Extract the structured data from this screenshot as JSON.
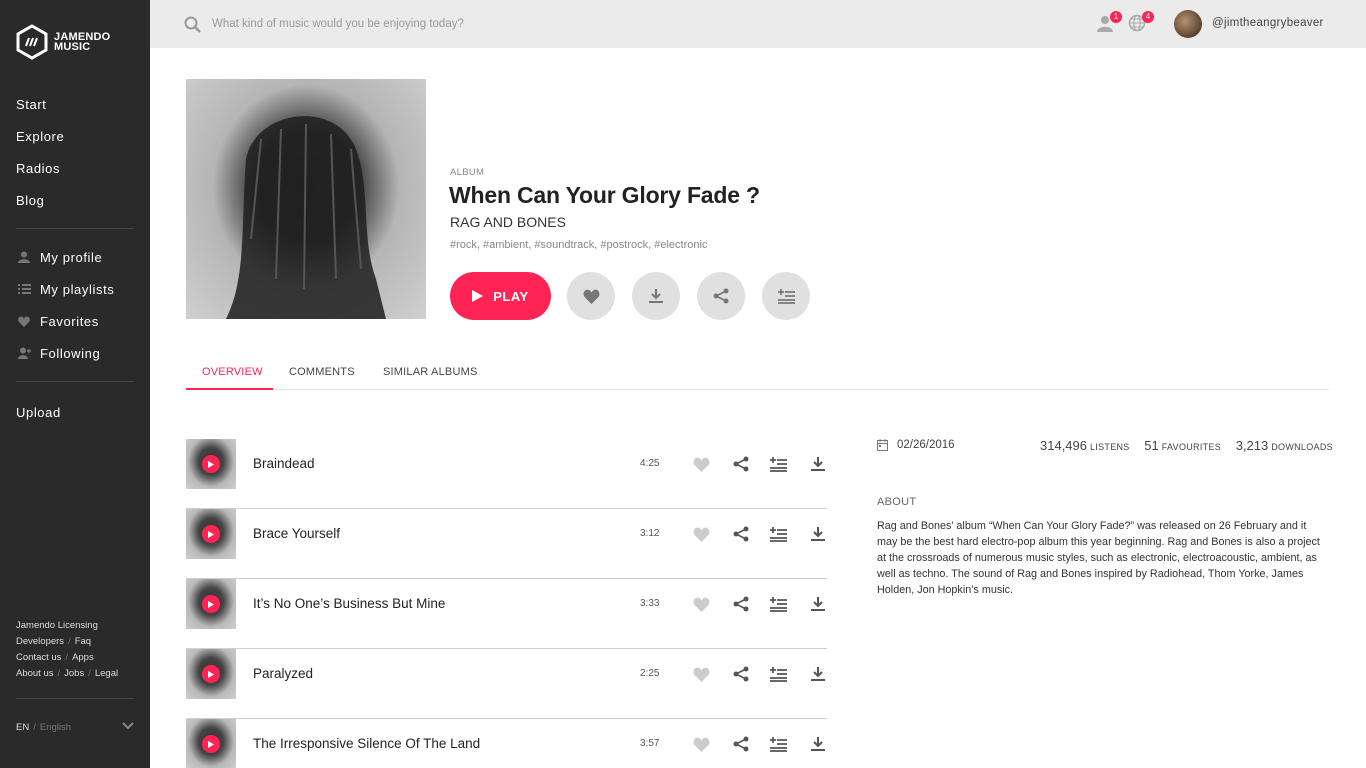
{
  "app": {
    "logo_line1": "JAMENDO",
    "logo_line2": "MUSIC",
    "accent": "#ff2454",
    "sidebar_bg": "#2a2a2a"
  },
  "sidebar": {
    "main_nav": [
      "Start",
      "Explore",
      "Radios",
      "Blog"
    ],
    "user_nav": [
      {
        "label": "My profile",
        "icon": "user-icon"
      },
      {
        "label": "My playlists",
        "icon": "playlist-icon"
      },
      {
        "label": "Favorites",
        "icon": "heart-icon"
      },
      {
        "label": "Following",
        "icon": "following-icon"
      }
    ],
    "upload": "Upload",
    "footer": {
      "licensing": "Jamendo Licensing",
      "developers": "Developers",
      "faq": "Faq",
      "contact": "Contact us",
      "apps": "Apps",
      "about": "About us",
      "jobs": "Jobs",
      "legal": "Legal",
      "sep": "/"
    },
    "language": {
      "code": "EN",
      "sep": "/",
      "name": "English"
    }
  },
  "topbar": {
    "search_placeholder": "What kind of music would you be enjoying today?",
    "notifications_count": "1",
    "world_count": "4",
    "username": "@jimtheangrybeaver"
  },
  "album": {
    "type_label": "ALBUM",
    "title": "When Can Your Glory Fade ?",
    "artist": "RAG AND BONES",
    "tags": "#rock, #ambient, #soundtrack, #postrock, #electronic",
    "play_label": "PLAY"
  },
  "tabs": [
    "OVERVIEW",
    "COMMENTS",
    "SIMILAR ALBUMS"
  ],
  "tracks": [
    {
      "title": "Braindead",
      "duration": "4:25"
    },
    {
      "title": "Brace Yourself",
      "duration": "3:12"
    },
    {
      "title": "It’s No One’s Business But Mine",
      "duration": "3:33"
    },
    {
      "title": "Paralyzed",
      "duration": "2:25"
    },
    {
      "title": "The Irresponsive Silence Of The Land",
      "duration": "3:57"
    }
  ],
  "info": {
    "date": "02/26/2016",
    "listens": "314,496",
    "listens_label": "LISTENS",
    "favourites": "51",
    "favourites_label": "FAVOURITES",
    "downloads": "3,213",
    "downloads_label": "DOWNLOADS",
    "about_heading": "ABOUT",
    "about_text": "Rag and Bones’ album “When Can Your Glory Fade?” was released on 26 February and it may be the best hard electro-pop album this year beginning. Rag and Bones is also a project at the crossroads of numerous music styles, such as electronic, electroacoustic, ambient, as well as techno. The sound of Rag and Bones inspired by Radiohead, Thom Yorke, James Holden, Jon Hopkin’s music."
  }
}
